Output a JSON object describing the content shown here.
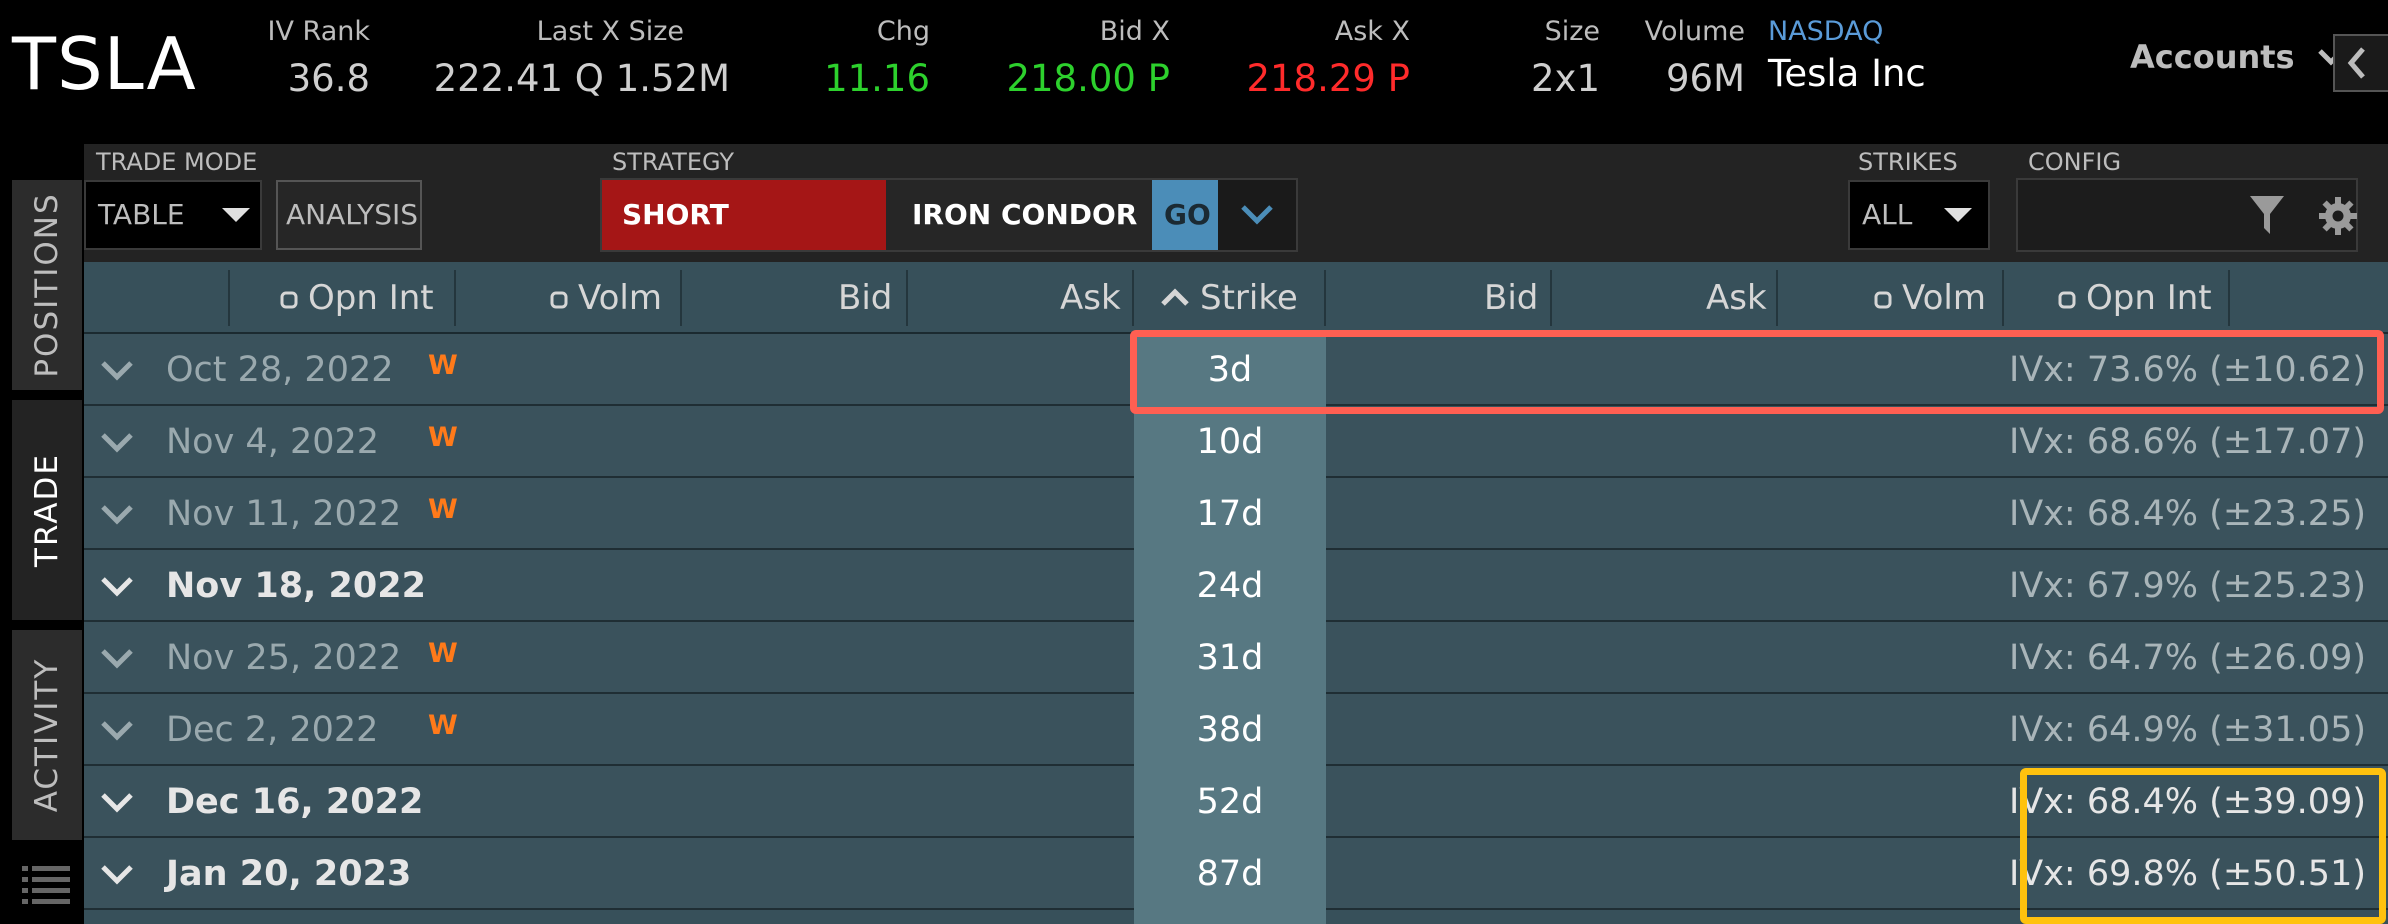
{
  "header": {
    "ticker": "TSLA",
    "stats": [
      {
        "label": "IV Rank",
        "value": "36.8",
        "color": "default"
      },
      {
        "label": "Last X Size",
        "value": "222.41 Q 1.52M",
        "color": "default"
      },
      {
        "label": "Chg",
        "value": "11.16",
        "color": "green"
      },
      {
        "label": "Bid X",
        "value": "218.00 P",
        "color": "green"
      },
      {
        "label": "Ask X",
        "value": "218.29 P",
        "color": "red"
      },
      {
        "label": "Size",
        "value": "2x1",
        "color": "default"
      },
      {
        "label": "Volume",
        "value": "96M",
        "color": "default"
      }
    ],
    "exchange": "NASDAQ",
    "company": "Tesla Inc",
    "accounts_label": "Accounts"
  },
  "side_tabs": [
    {
      "label": "POSITIONS",
      "active": false
    },
    {
      "label": "TRADE",
      "active": true
    },
    {
      "label": "ACTIVITY",
      "active": false
    }
  ],
  "toolbar": {
    "trade_mode_label": "TRADE MODE",
    "trade_mode_value": "TABLE",
    "analysis_label": "ANALYSIS",
    "strategy_label": "STRATEGY",
    "strategy_side": "SHORT",
    "strategy_name": "IRON CONDOR",
    "go_label": "GO",
    "strikes_label": "STRIKES",
    "strikes_value": "ALL",
    "config_label": "CONFIG"
  },
  "columns": {
    "opn_int_left": "Opn Int",
    "volm_left": "Volm",
    "bid_left": "Bid",
    "ask_left": "Ask",
    "strike": "Strike",
    "bid_right": "Bid",
    "ask_right": "Ask",
    "volm_right": "Volm",
    "opn_int_right": "Opn Int"
  },
  "expirations": [
    {
      "date": "Oct 28, 2022",
      "weekly": "W",
      "dte": "3d",
      "ivx": "IVx: 73.6% (±10.62)",
      "bold": false
    },
    {
      "date": "Nov 4, 2022",
      "weekly": "W",
      "dte": "10d",
      "ivx": "IVx: 68.6% (±17.07)",
      "bold": false
    },
    {
      "date": "Nov 11, 2022",
      "weekly": "W",
      "dte": "17d",
      "ivx": "IVx: 68.4% (±23.25)",
      "bold": false
    },
    {
      "date": "Nov 18, 2022",
      "weekly": "",
      "dte": "24d",
      "ivx": "IVx: 67.9% (±25.23)",
      "bold": true
    },
    {
      "date": "Nov 25, 2022",
      "weekly": "W",
      "dte": "31d",
      "ivx": "IVx: 64.7% (±26.09)",
      "bold": false
    },
    {
      "date": "Dec 2, 2022",
      "weekly": "W",
      "dte": "38d",
      "ivx": "IVx: 64.9% (±31.05)",
      "bold": false
    },
    {
      "date": "Dec 16, 2022",
      "weekly": "",
      "dte": "52d",
      "ivx": "IVx: 68.4% (±39.09)",
      "bold": true
    },
    {
      "date": "Jan 20, 2023",
      "weekly": "",
      "dte": "87d",
      "ivx": "IVx: 69.8% (±50.51)",
      "bold": true
    }
  ],
  "colors": {
    "chg_green": "#2dd12d",
    "ask_red": "#ff2b2b",
    "short_red": "#a51616",
    "go_blue": "#4b8db8",
    "weekly_orange": "#ff7a1a",
    "highlight_red": "#ff5f52",
    "highlight_yellow": "#ffc20e"
  }
}
